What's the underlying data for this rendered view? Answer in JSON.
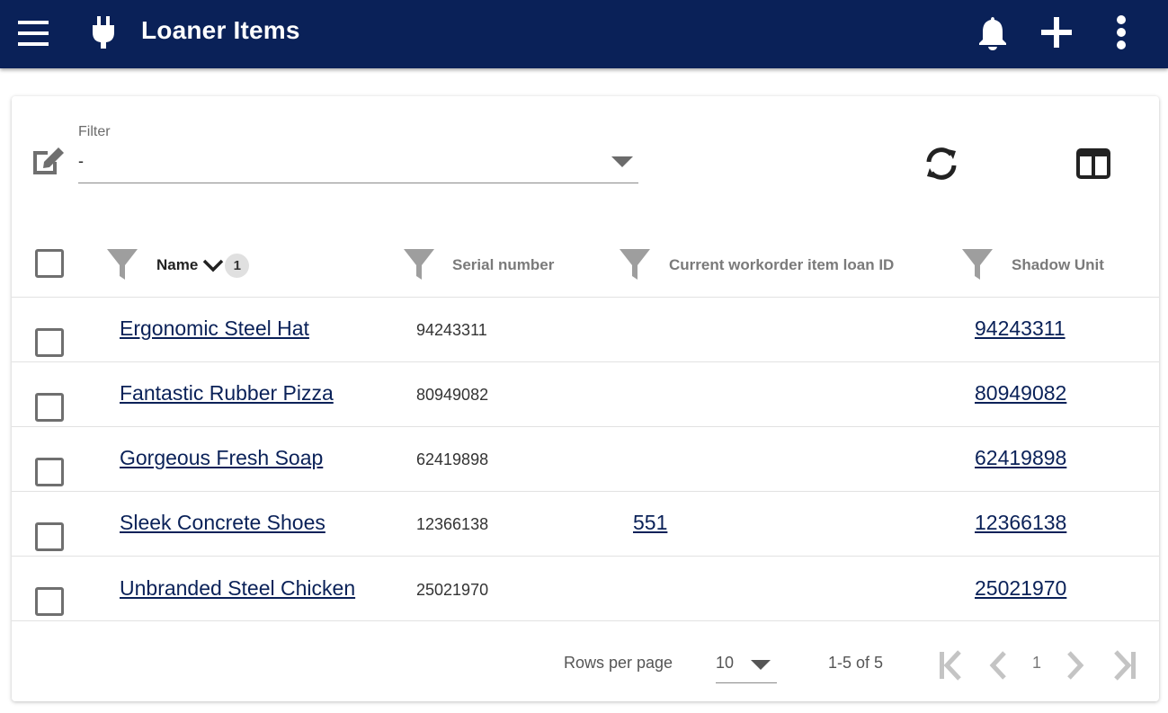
{
  "appbar": {
    "title": "Loaner Items",
    "icons": [
      "menu-icon",
      "plug-icon",
      "bell-icon",
      "plus-icon",
      "more-vertical-icon"
    ],
    "background": "#0a2158"
  },
  "toolbar": {
    "filter_label": "Filter",
    "filter_value": "-",
    "icons": [
      "edit-icon",
      "refresh-icon",
      "columns-icon"
    ]
  },
  "table": {
    "columns": [
      {
        "label": "Name",
        "sorted": true,
        "sort_direction": "desc",
        "sort_badge": "1"
      },
      {
        "label": "Serial number"
      },
      {
        "label": "Current workorder item loan ID"
      },
      {
        "label": "Shadow Unit"
      }
    ],
    "rows": [
      {
        "name": "Ergonomic Steel Hat",
        "serial": "94243311",
        "loan_id": "",
        "shadow_unit": "94243311"
      },
      {
        "name": "Fantastic Rubber Pizza",
        "serial": "80949082",
        "loan_id": "",
        "shadow_unit": "80949082"
      },
      {
        "name": "Gorgeous Fresh Soap",
        "serial": "62419898",
        "loan_id": "",
        "shadow_unit": "62419898"
      },
      {
        "name": "Sleek Concrete Shoes",
        "serial": "12366138",
        "loan_id": "551",
        "shadow_unit": "12366138"
      },
      {
        "name": "Unbranded Steel Chicken",
        "serial": "25021970",
        "loan_id": "",
        "shadow_unit": "25021970"
      }
    ]
  },
  "pagination": {
    "rows_per_page_label": "Rows per page",
    "rows_per_page_value": "10",
    "range_text": "1-5 of 5",
    "current_page": "1"
  },
  "colors": {
    "link": "#0a2158",
    "icon_gray": "#9e9e9e"
  }
}
